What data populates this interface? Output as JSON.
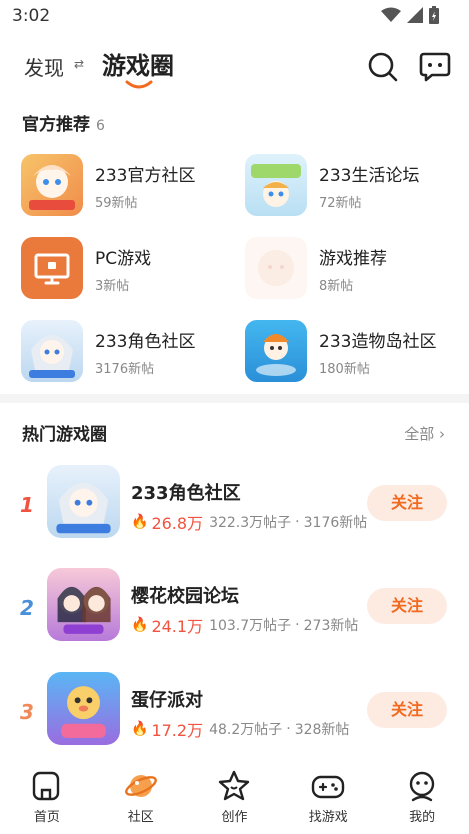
{
  "status": {
    "time": "3:02"
  },
  "header": {
    "tab_discover": "发现",
    "tab_active": "游戏圈"
  },
  "official": {
    "title": "官方推荐",
    "count": "6",
    "items": [
      {
        "name": "233官方社区",
        "sub": "59新帖"
      },
      {
        "name": "233生活论坛",
        "sub": "72新帖"
      },
      {
        "name": "PC游戏",
        "sub": "3新帖"
      },
      {
        "name": "游戏推荐",
        "sub": "8新帖"
      },
      {
        "name": "233角色社区",
        "sub": "3176新帖"
      },
      {
        "name": "233造物岛社区",
        "sub": "180新帖"
      }
    ]
  },
  "hot": {
    "title": "热门游戏圈",
    "all_label": "全部",
    "items": [
      {
        "rank": "1",
        "name": "233角色社区",
        "heat": "26.8万",
        "posts": "322.3万帖子",
        "new": "3176新帖",
        "follow": "关注"
      },
      {
        "rank": "2",
        "name": "樱花校园论坛",
        "heat": "24.1万",
        "posts": "103.7万帖子",
        "new": "273新帖",
        "follow": "关注"
      },
      {
        "rank": "3",
        "name": "蛋仔派对",
        "heat": "17.2万",
        "posts": "48.2万帖子",
        "new": "328新帖",
        "follow": "关注"
      }
    ]
  },
  "nav": {
    "home": "首页",
    "community": "社区",
    "create": "创作",
    "find_game": "找游戏",
    "mine": "我的"
  },
  "colors": {
    "accent": "#f06a1f",
    "heat": "#f0533f"
  }
}
